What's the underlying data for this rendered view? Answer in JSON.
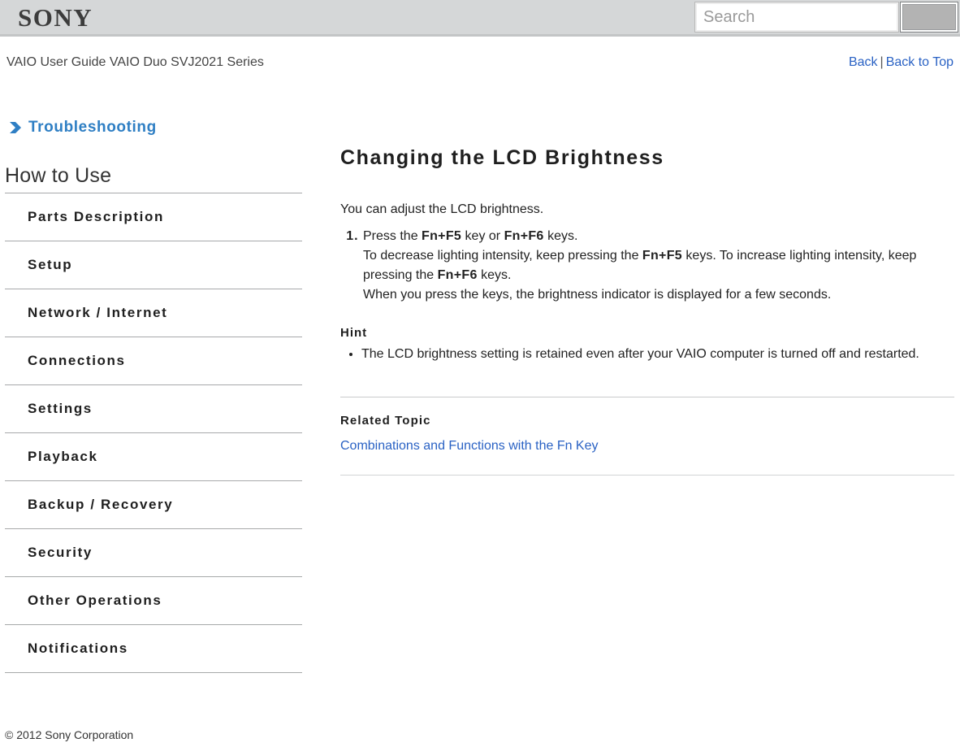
{
  "header": {
    "logo_text": "SONY",
    "search": {
      "placeholder": "Search",
      "value": "",
      "button_label": ""
    }
  },
  "subheader": {
    "guide_title": "VAIO User Guide VAIO Duo SVJ2021 Series",
    "back_label": "Back",
    "separator": "|",
    "back_to_top_label": "Back to Top"
  },
  "sidebar": {
    "troubleshooting": {
      "icon": "chevron-right-icon",
      "label": "Troubleshooting",
      "color": "#2f7fc4"
    },
    "section_title": "How to Use",
    "items": [
      {
        "label": "Parts Description"
      },
      {
        "label": "Setup"
      },
      {
        "label": "Network / Internet"
      },
      {
        "label": "Connections"
      },
      {
        "label": "Settings"
      },
      {
        "label": "Playback"
      },
      {
        "label": "Backup / Recovery"
      },
      {
        "label": "Security"
      },
      {
        "label": "Other Operations"
      },
      {
        "label": "Notifications"
      }
    ]
  },
  "footer": {
    "copyright": "© 2012 Sony Corporation"
  },
  "main": {
    "title": "Changing the LCD Brightness",
    "lead": "You can adjust the LCD brightness.",
    "step1": {
      "part_a": "Press the ",
      "key1": "Fn+F5",
      "part_b": " key or ",
      "key2": "Fn+F6",
      "part_c": " keys.",
      "line2_a": "To decrease lighting intensity, keep pressing the ",
      "line2_key": "Fn+F5",
      "line2_b": " keys. To increase lighting intensity, keep pressing the ",
      "line2_key2": "Fn+F6",
      "line2_c": " keys.",
      "line3": "When you press the keys, the brightness indicator is displayed for a few seconds."
    },
    "hint_heading": "Hint",
    "hint_bullets": [
      "The LCD brightness setting is retained even after your VAIO computer is turned off and restarted."
    ],
    "related_heading": "Related Topic",
    "related_links": [
      {
        "label": "Combinations and Functions with the Fn Key"
      }
    ]
  },
  "colors": {
    "link": "#2a62c4",
    "accent": "#2f7fc4",
    "header_band": "#d5d7d8",
    "rule": "#a7a9aa"
  }
}
